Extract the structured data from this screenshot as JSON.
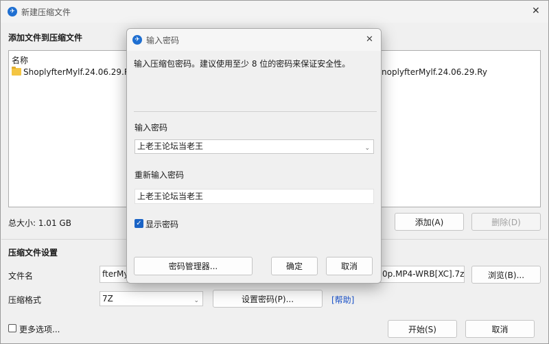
{
  "main_window": {
    "title": "新建压缩文件",
    "close_glyph": "✕",
    "add_section_heading": "添加文件到压缩文件",
    "file_list": {
      "column_header": "名称",
      "item_left": "ShoplyfterMylf.24.06.29.Ry",
      "item_right": "noplyfterMylf.24.06.29.Ry"
    },
    "total_size": "总大小: 1.01 GB",
    "add_button": "添加(A)",
    "delete_button": "删除(D)",
    "settings_heading": "压缩文件设置",
    "filename_label": "文件名",
    "filename_value_left": "fterMy",
    "filename_value_right": "0p.MP4-WRB[XC].7z",
    "browse_button": "浏览(B)...",
    "format_label": "压缩格式",
    "format_value": "7Z",
    "set_password_button": "设置密码(P)...",
    "help_link": "[帮助]",
    "more_options_label": "更多选项...",
    "start_button": "开始(S)",
    "cancel_button": "取消"
  },
  "password_dialog": {
    "title": "输入密码",
    "close_glyph": "✕",
    "description": "输入压缩包密码。建议使用至少 8 位的密码来保证安全性。",
    "password_label": "输入密码",
    "password_value": "上老王论坛当老王",
    "confirm_label": "重新输入密码",
    "confirm_value": "上老王论坛当老王",
    "show_password_label": "显示密码",
    "show_password_checked": true,
    "manager_button": "密码管理器...",
    "ok_button": "确定",
    "cancel_button": "取消"
  },
  "icons": {
    "app_icon_glyph": "✈",
    "chevron": "⌄",
    "check": "✓"
  },
  "colors": {
    "accent": "#1a63c5",
    "link": "#1a52c9",
    "folder": "#f4c542"
  }
}
